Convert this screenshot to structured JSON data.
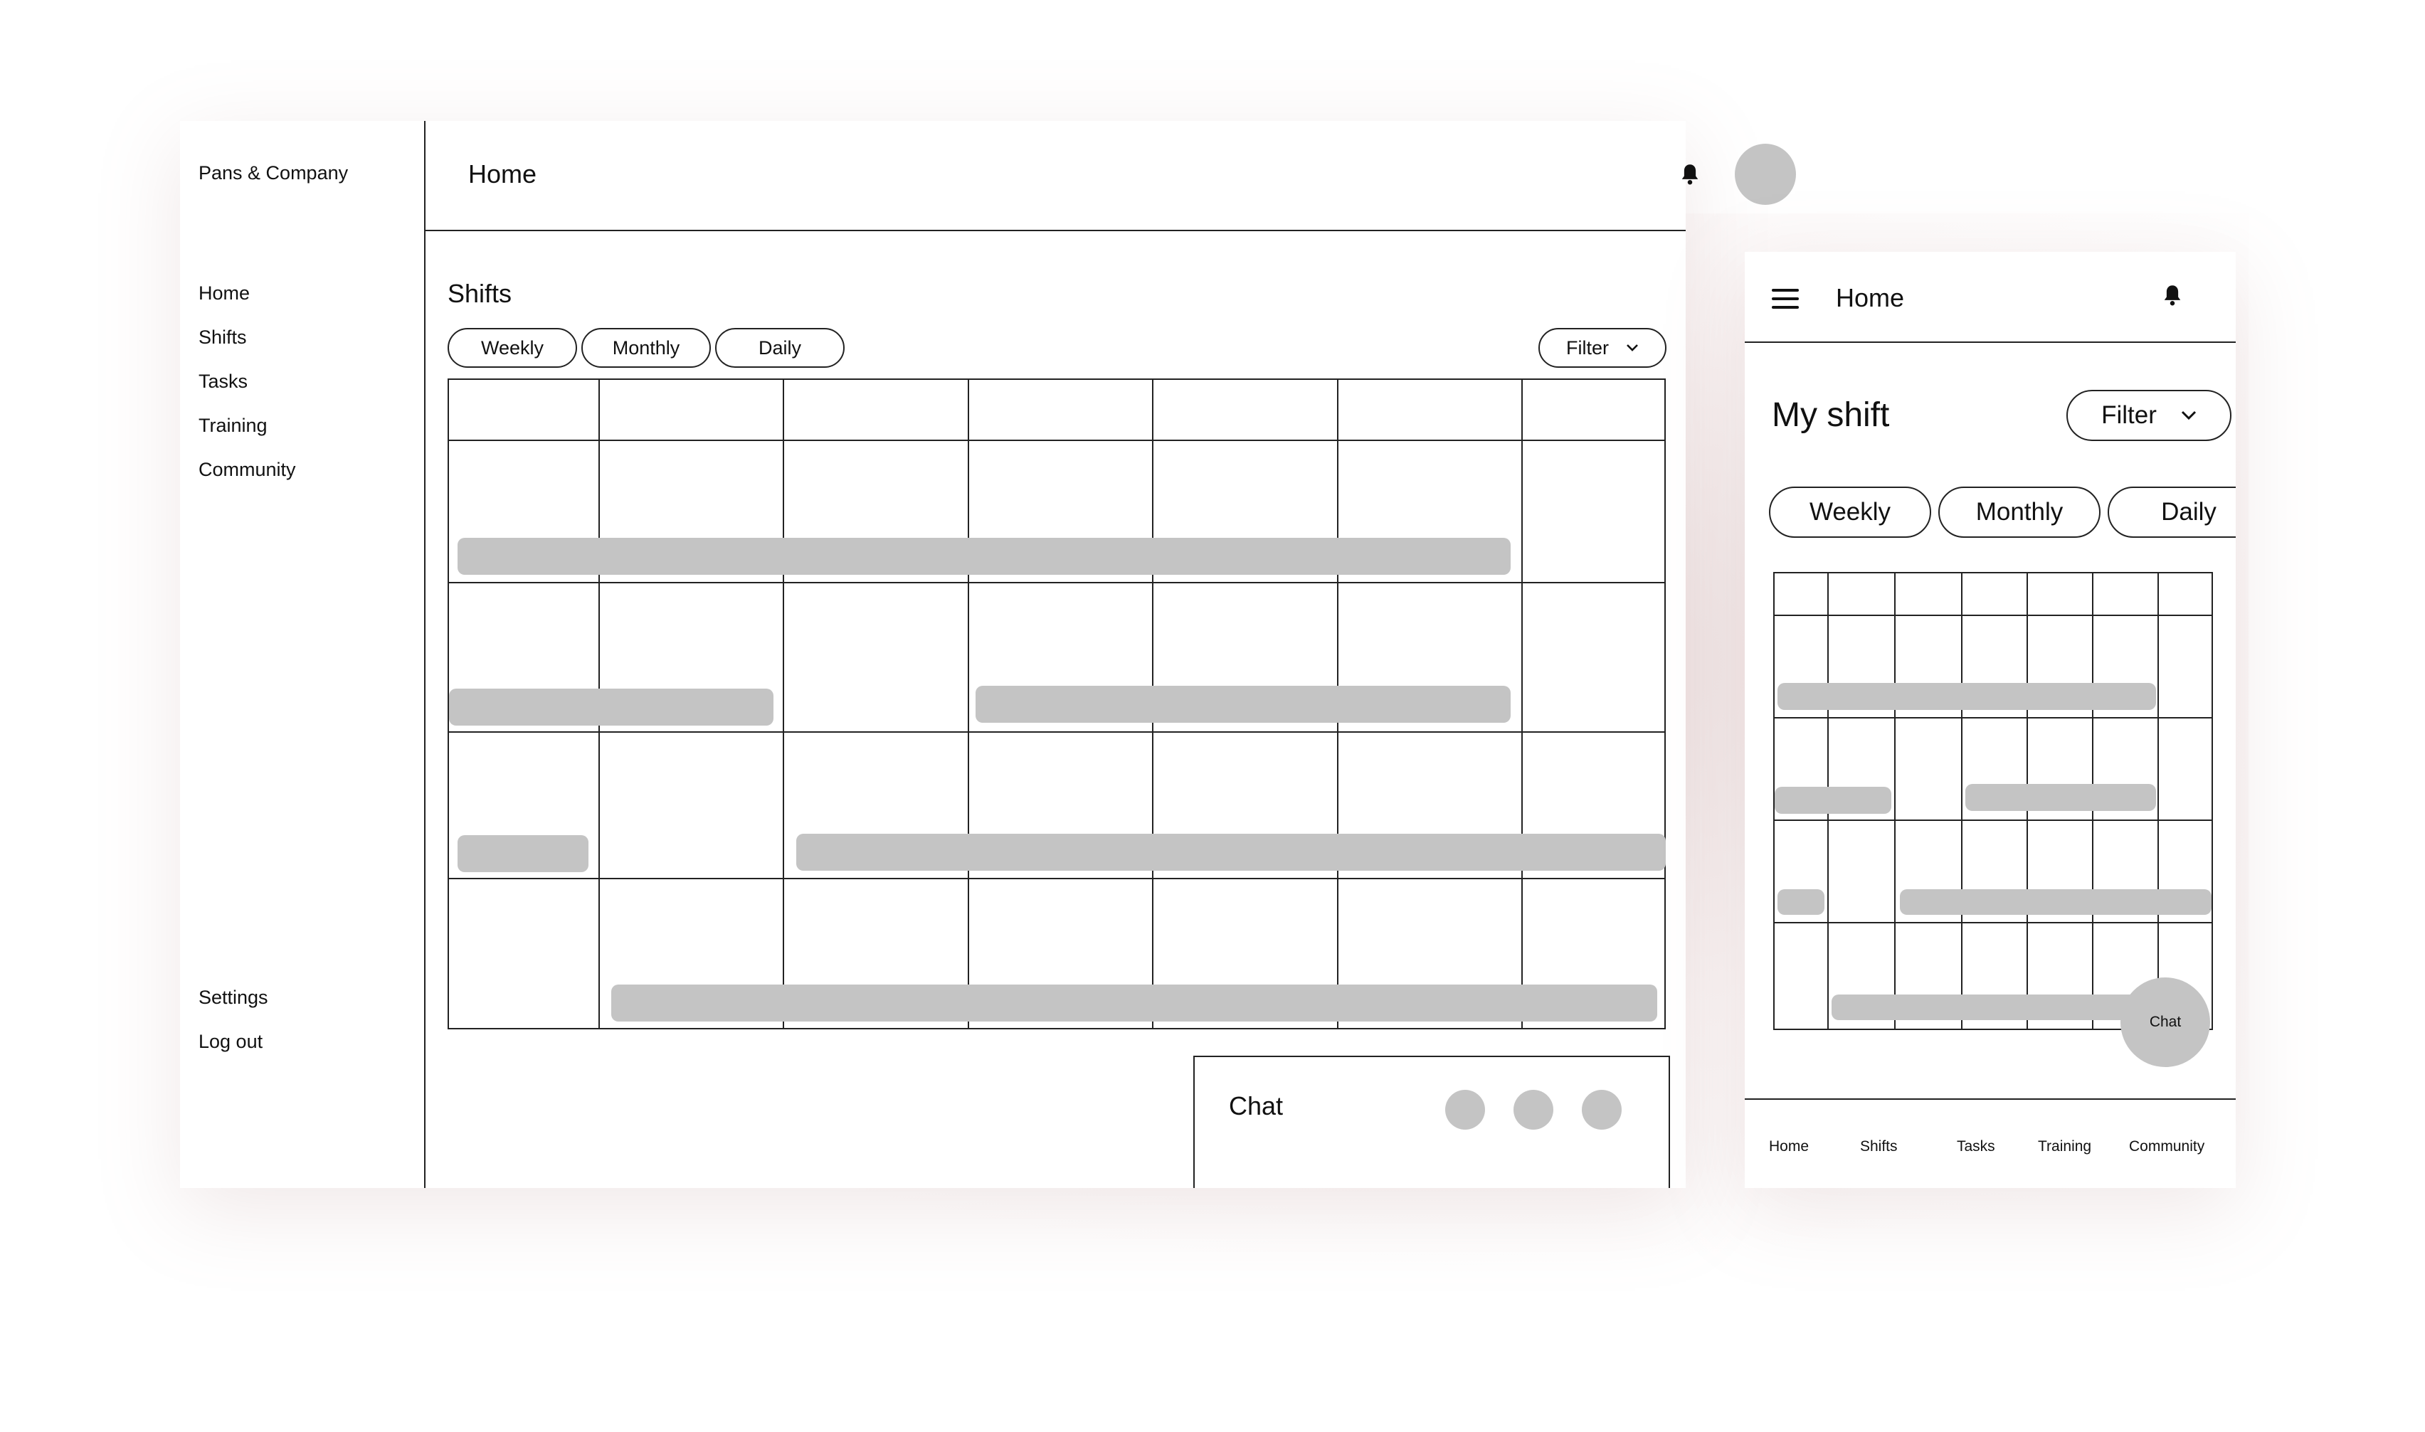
{
  "desktop": {
    "brand": "Pans & Company",
    "nav": [
      "Home",
      "Shifts",
      "Tasks",
      "Training",
      "Community"
    ],
    "nav_bottom": [
      "Settings",
      "Log out"
    ],
    "header_title": "Home",
    "section_title": "Shifts",
    "view_toggles": [
      "Weekly",
      "Monthly",
      "Daily"
    ],
    "filter_label": "Filter",
    "chat_title": "Chat"
  },
  "mobile": {
    "header_title": "Home",
    "page_title": "My shift",
    "filter_label": "Filter",
    "view_toggles": [
      "Weekly",
      "Monthly",
      "Daily"
    ],
    "chat_fab_label": "Chat",
    "tabbar": [
      "Home",
      "Shifts",
      "Tasks",
      "Training",
      "Community"
    ]
  },
  "colors": {
    "placeholder_fill": "#c4c4c4",
    "line": "#222222",
    "backdrop_glow": "#ecdede"
  },
  "icons": [
    "bell-icon",
    "hamburger-icon",
    "chevron-down-icon"
  ]
}
